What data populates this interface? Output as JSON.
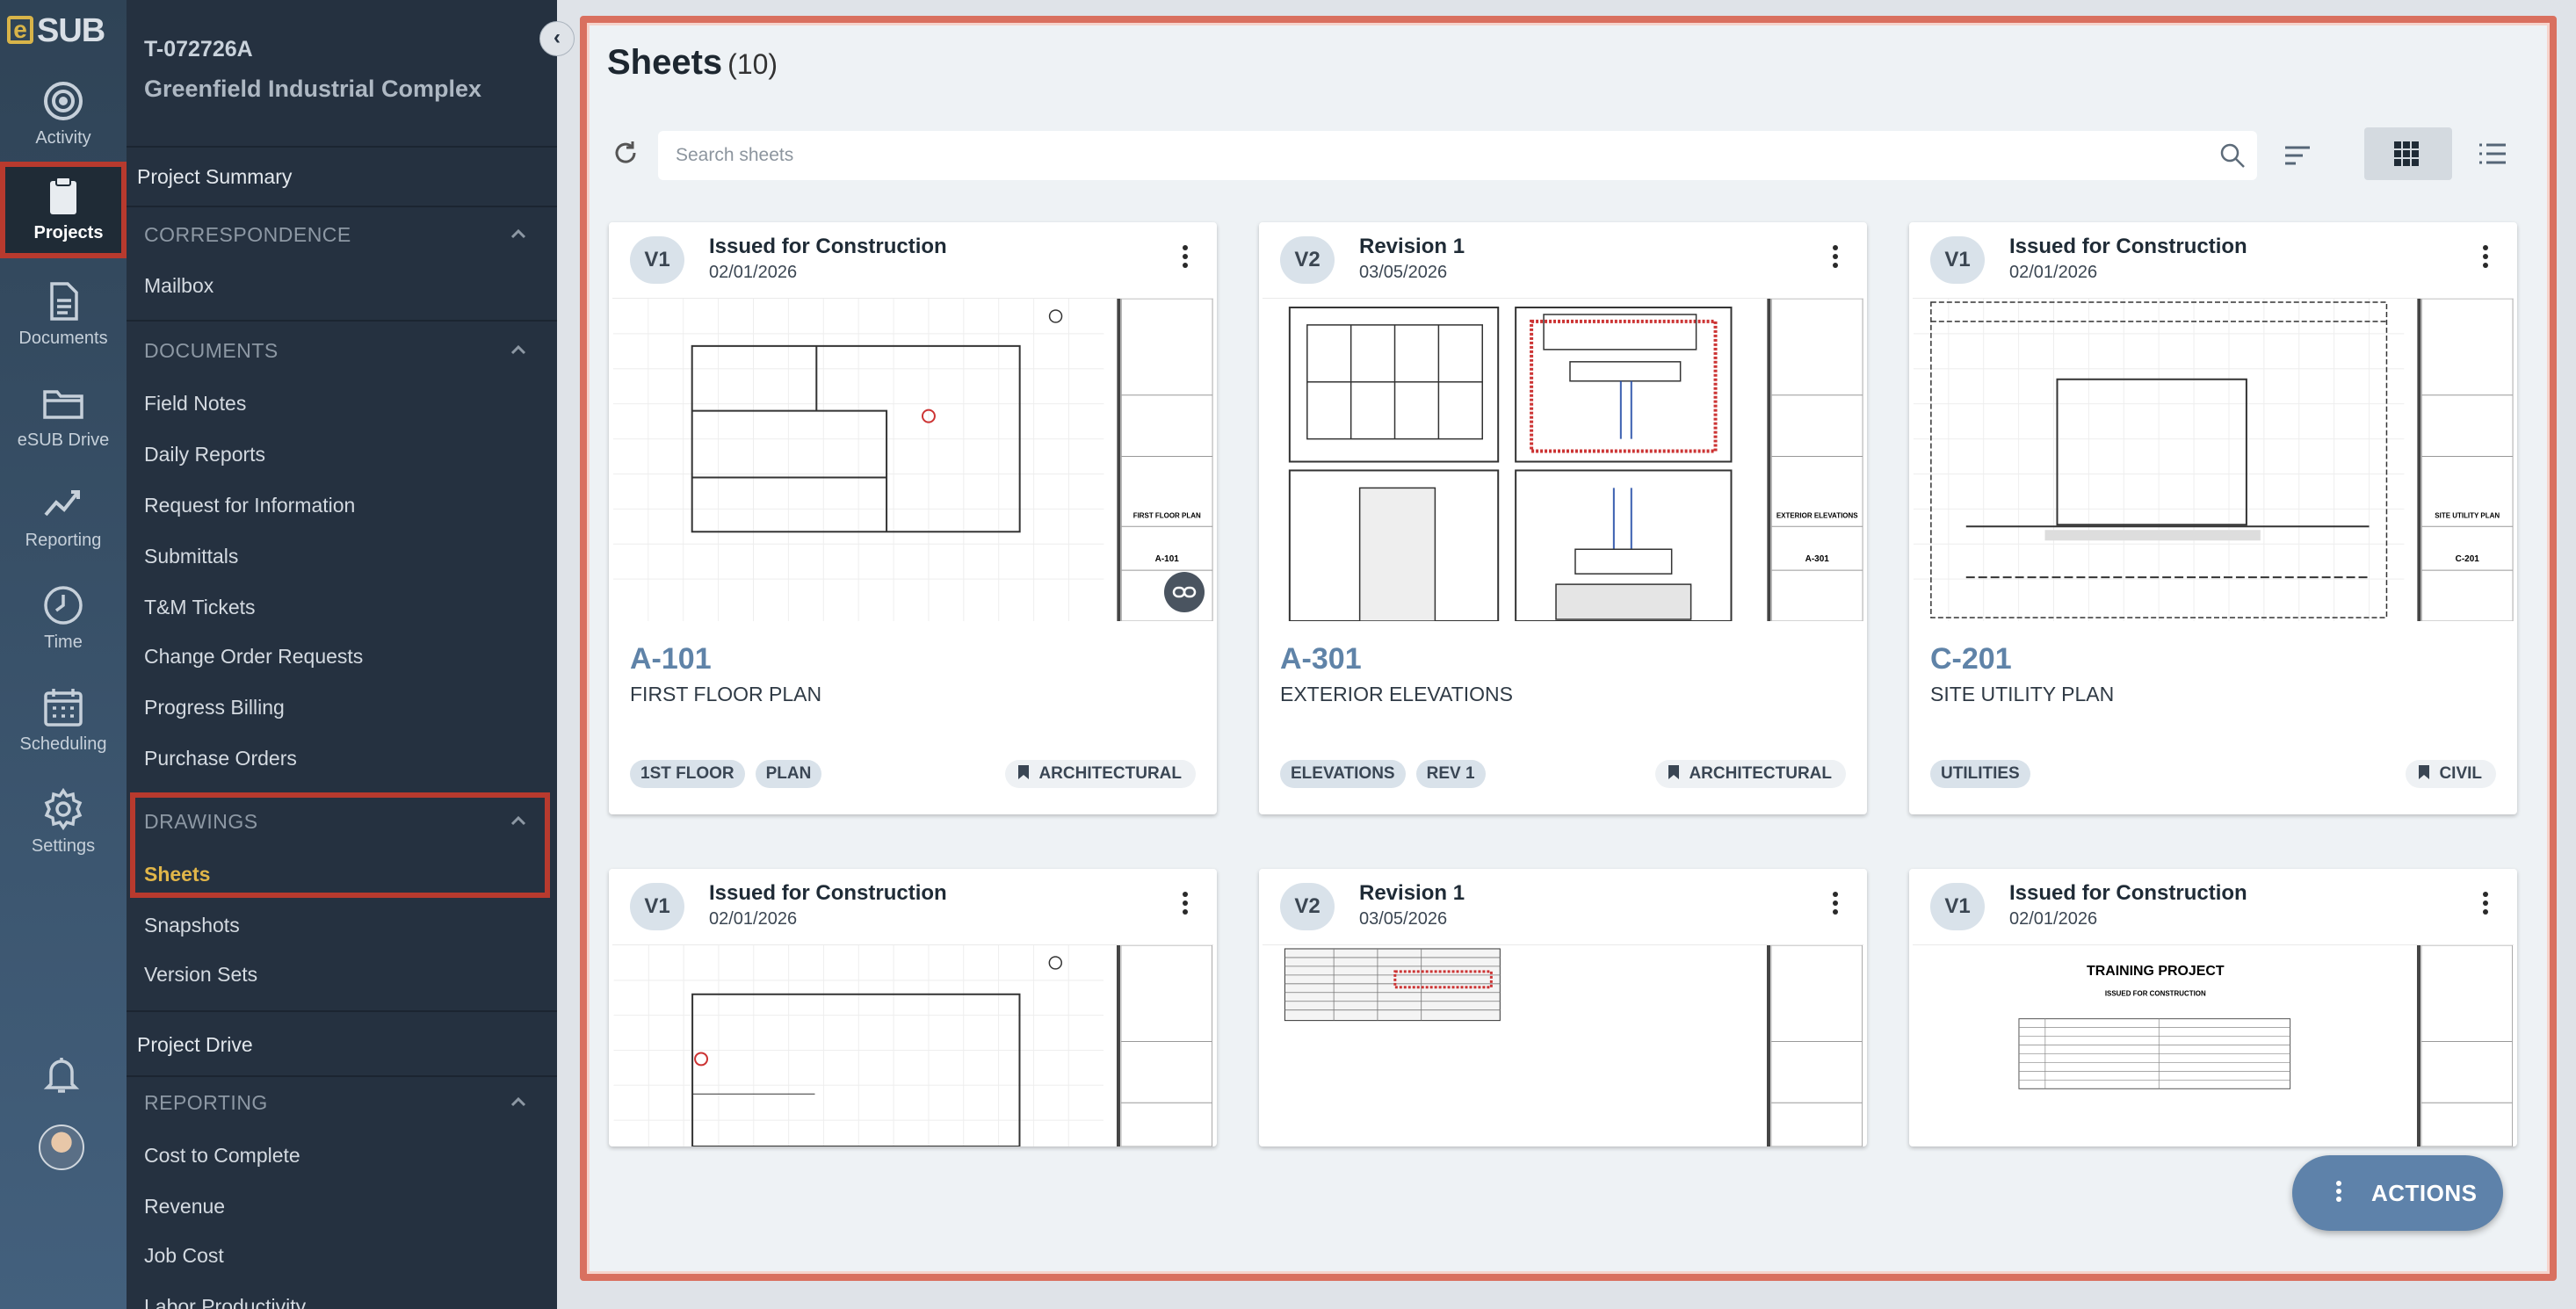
{
  "brand": {
    "logo_letter": "e",
    "logo_text": "SUB"
  },
  "rail": {
    "items": [
      {
        "label": "Activity",
        "icon": "activity-icon"
      },
      {
        "label": "Projects",
        "icon": "clipboard-icon",
        "active": true
      },
      {
        "label": "Documents",
        "icon": "document-icon"
      },
      {
        "label": "eSUB Drive",
        "icon": "folder-icon"
      },
      {
        "label": "Reporting",
        "icon": "chart-line-icon"
      },
      {
        "label": "Time",
        "icon": "clock-icon"
      },
      {
        "label": "Scheduling",
        "icon": "calendar-icon"
      },
      {
        "label": "Settings",
        "icon": "gear-icon"
      }
    ]
  },
  "project": {
    "id": "T-072726A",
    "name": "Greenfield Industrial Complex"
  },
  "nav": {
    "project_summary": "Project Summary",
    "correspondence": {
      "title": "CORRESPONDENCE",
      "items": [
        "Mailbox"
      ]
    },
    "documents": {
      "title": "DOCUMENTS",
      "items": [
        "Field Notes",
        "Daily Reports",
        "Request for Information",
        "Submittals",
        "T&M Tickets",
        "Change Order Requests",
        "Progress Billing",
        "Purchase Orders"
      ]
    },
    "drawings": {
      "title": "DRAWINGS",
      "items": [
        "Sheets",
        "Snapshots",
        "Version Sets"
      ],
      "active": "Sheets"
    },
    "project_drive": "Project Drive",
    "reporting": {
      "title": "REPORTING",
      "items": [
        "Cost to Complete",
        "Revenue",
        "Job Cost",
        "Labor Productivity"
      ]
    }
  },
  "main": {
    "title": "Sheets",
    "count": "(10)",
    "search_placeholder": "Search sheets",
    "actions_label": "ACTIONS"
  },
  "cards": [
    {
      "version": "V1",
      "status": "Issued for Construction",
      "date": "02/01/2026",
      "number": "A-101",
      "name": "FIRST FLOOR PLAN",
      "tags": [
        "1ST FLOOR",
        "PLAN"
      ],
      "discipline": "ARCHITECTURAL",
      "title_block": "FIRST FLOOR PLAN",
      "sheet_id": "A-101"
    },
    {
      "version": "V2",
      "status": "Revision 1",
      "date": "03/05/2026",
      "number": "A-301",
      "name": "EXTERIOR ELEVATIONS",
      "tags": [
        "ELEVATIONS",
        "REV 1"
      ],
      "discipline": "ARCHITECTURAL",
      "title_block": "EXTERIOR ELEVATIONS",
      "sheet_id": "A-301"
    },
    {
      "version": "V1",
      "status": "Issued for Construction",
      "date": "02/01/2026",
      "number": "C-201",
      "name": "SITE UTILITY PLAN",
      "tags": [
        "UTILITIES"
      ],
      "discipline": "CIVIL",
      "title_block": "SITE UTILITY PLAN",
      "sheet_id": "C-201"
    },
    {
      "version": "V1",
      "status": "Issued for Construction",
      "date": "02/01/2026"
    },
    {
      "version": "V2",
      "status": "Revision 1",
      "date": "03/05/2026"
    },
    {
      "version": "V1",
      "status": "Issued for Construction",
      "date": "02/01/2026",
      "cover_title": "TRAINING PROJECT",
      "cover_subtitle": "ISSUED FOR CONSTRUCTION"
    }
  ]
}
